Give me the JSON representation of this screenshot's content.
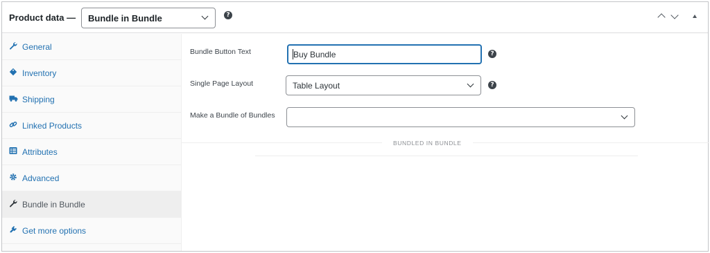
{
  "header": {
    "title": "Product data —",
    "product_type": "Bundle in Bundle",
    "help_glyph": "?"
  },
  "tabs": [
    {
      "label": "General",
      "icon": "wrench-icon"
    },
    {
      "label": "Inventory",
      "icon": "tag-icon"
    },
    {
      "label": "Shipping",
      "icon": "truck-icon"
    },
    {
      "label": "Linked Products",
      "icon": "link-icon"
    },
    {
      "label": "Attributes",
      "icon": "list-icon"
    },
    {
      "label": "Advanced",
      "icon": "gear-icon"
    },
    {
      "label": "Bundle in Bundle",
      "icon": "wrench-icon",
      "active": true
    },
    {
      "label": "Get more options",
      "icon": "plugin-icon"
    }
  ],
  "fields": {
    "button_text": {
      "label": "Bundle Button Text",
      "value": "Buy Bundle"
    },
    "layout": {
      "label": "Single Page Layout",
      "value": "Table Layout"
    },
    "bundle_of_bundles": {
      "label": "Make a Bundle of Bundles",
      "value": ""
    }
  },
  "section": {
    "title": "BUNDLED IN BUNDLE"
  },
  "colors": {
    "link": "#2271b1",
    "focus_border": "#2271b1",
    "active_tab_bg": "#eeeeee"
  }
}
